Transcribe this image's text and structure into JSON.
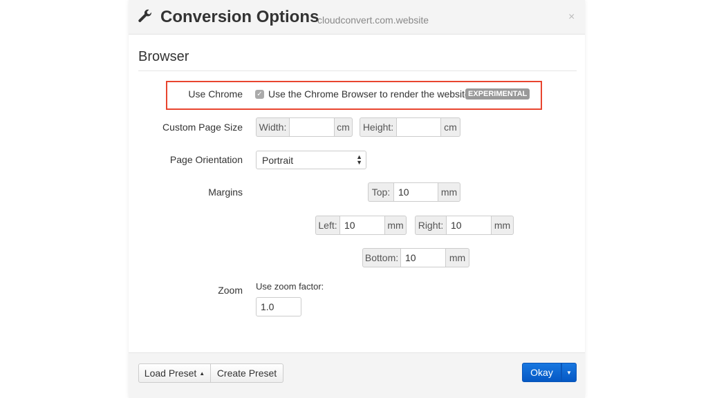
{
  "header": {
    "title": "Conversion Options",
    "subtitle": "cloudconvert.com.website",
    "icon": "wrench-icon",
    "close": "×"
  },
  "section": "Browser",
  "use_chrome": {
    "label": "Use Chrome",
    "checked": true,
    "text": "Use the Chrome Browser to render the website.",
    "badge": "EXPERIMENTAL"
  },
  "page_size": {
    "label": "Custom Page Size",
    "width_label": "Width:",
    "width_value": "",
    "width_unit": "cm",
    "height_label": "Height:",
    "height_value": "",
    "height_unit": "cm"
  },
  "orientation": {
    "label": "Page Orientation",
    "value": "Portrait"
  },
  "margins": {
    "label": "Margins",
    "top_label": "Top:",
    "top": "10",
    "left_label": "Left:",
    "left": "10",
    "right_label": "Right:",
    "right": "10",
    "bottom_label": "Bottom:",
    "bottom": "10",
    "unit": "mm"
  },
  "zoom": {
    "label": "Zoom",
    "hint": "Use zoom factor:",
    "value": "1.0"
  },
  "footer": {
    "load_preset": "Load Preset",
    "create_preset": "Create Preset",
    "okay": "Okay"
  },
  "colors": {
    "primary": "#0a63d1",
    "highlight": "#e8442e",
    "badge": "#999999"
  }
}
